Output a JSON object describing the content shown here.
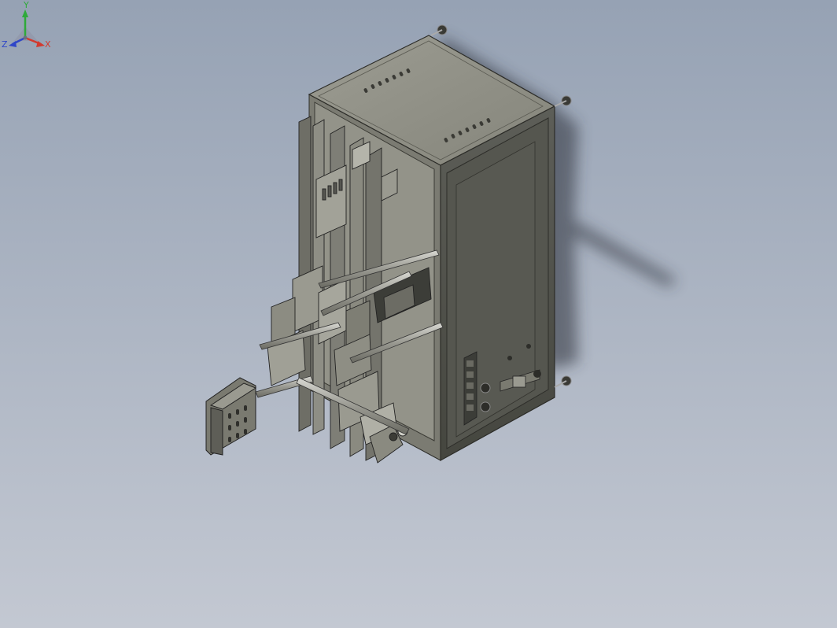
{
  "view": {
    "model_name": "",
    "background_top": "#96a2b4",
    "background_bottom": "#c3c8d2"
  },
  "triad": {
    "x_label": "X",
    "y_label": "Y",
    "z_label": "Z",
    "x_color": "#d23a2f",
    "y_color": "#2faa3a",
    "z_color": "#2f46c8"
  }
}
